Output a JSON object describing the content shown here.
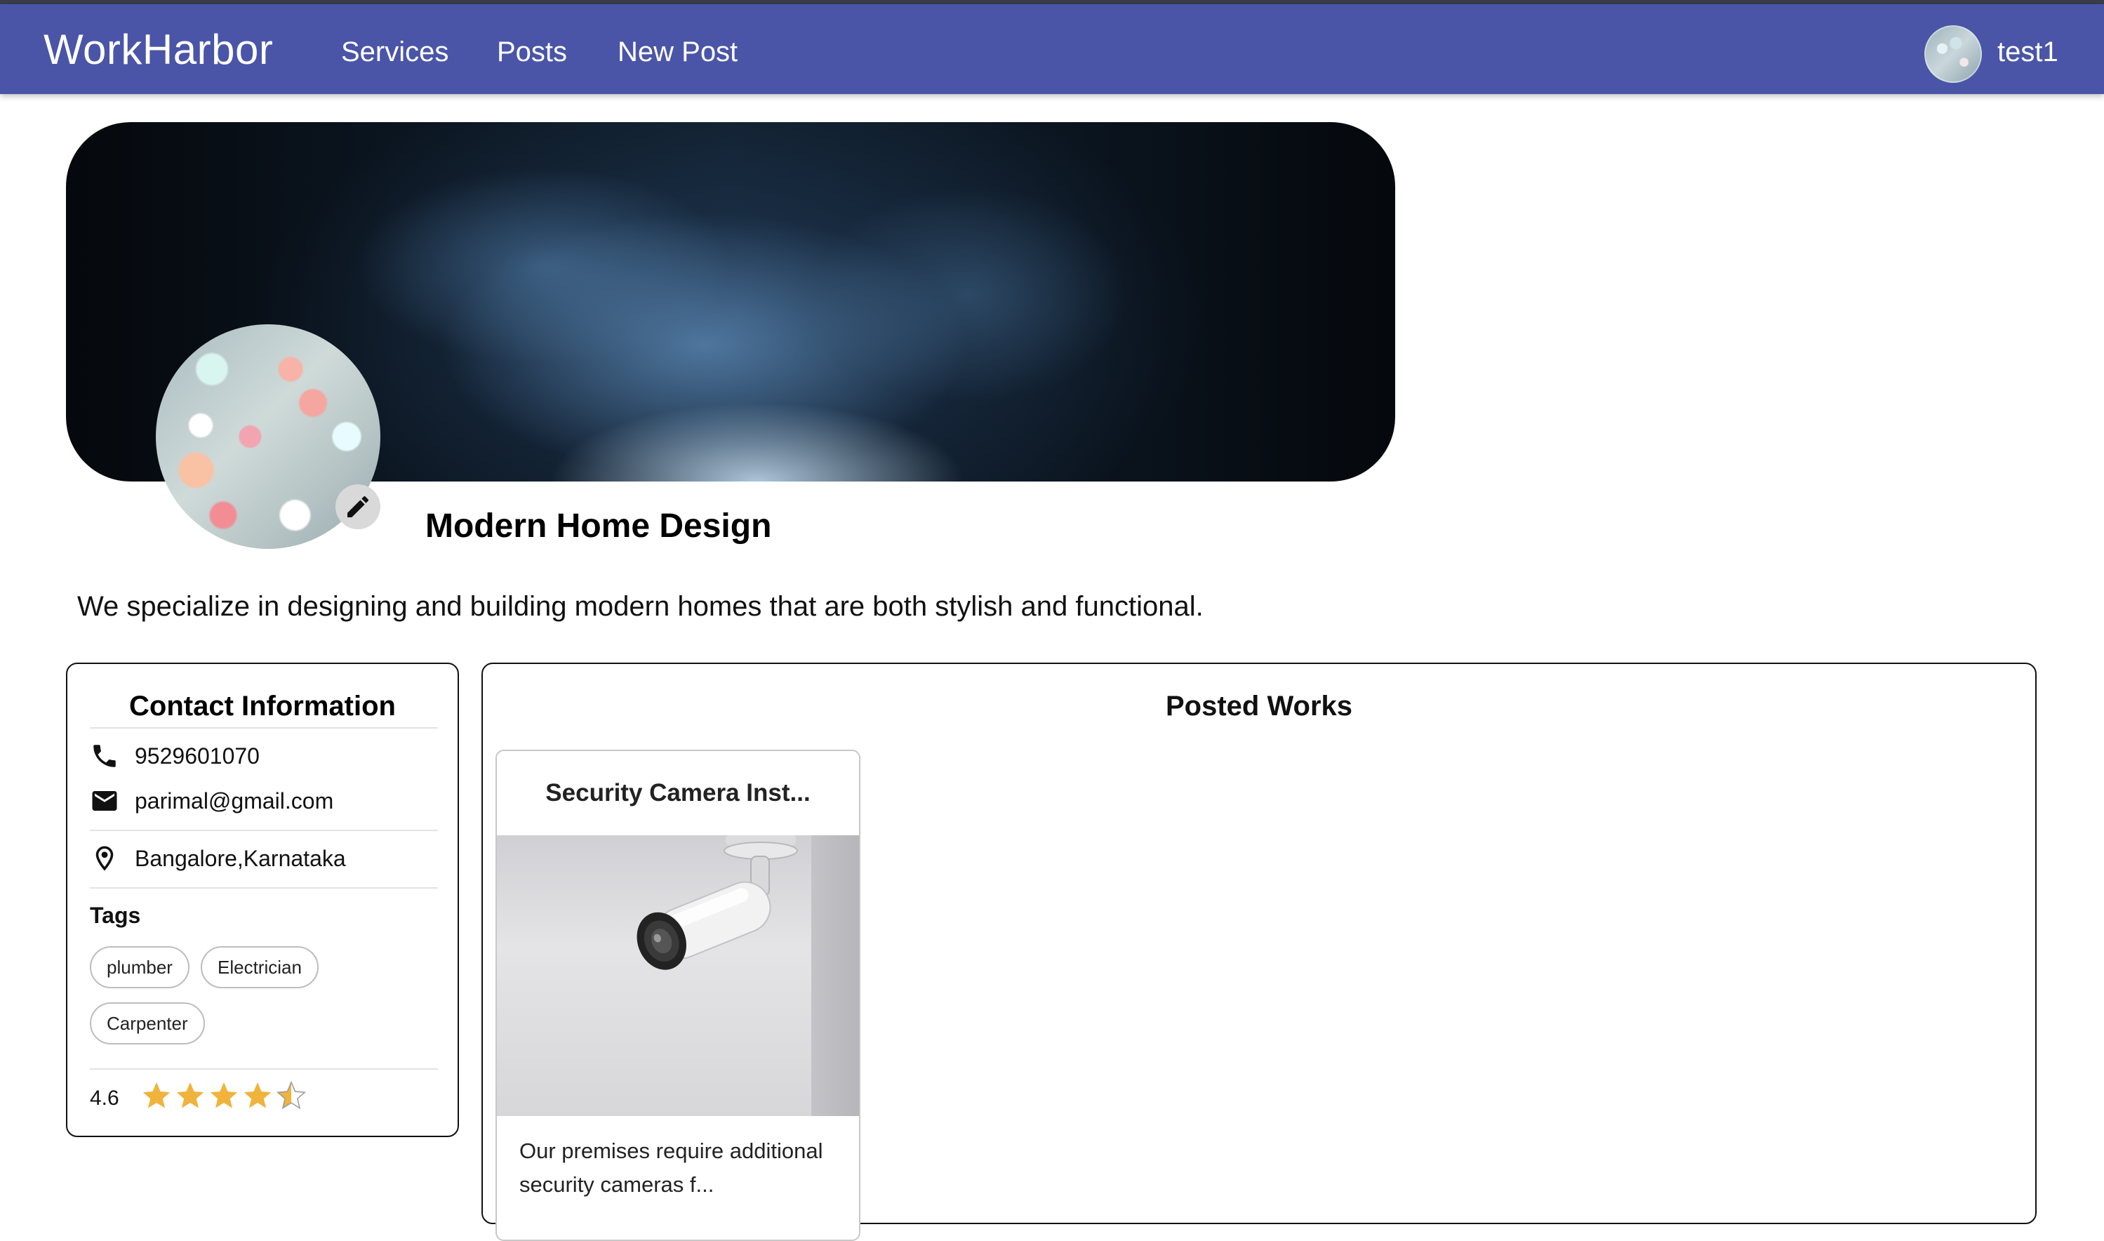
{
  "appbar": {
    "brand": "WorkHarbor",
    "nav": [
      "Services",
      "Posts",
      "New Post"
    ],
    "user": "test1"
  },
  "profile": {
    "title": "Modern Home Design",
    "description": "We specialize in designing and building modern homes that are both stylish and functional."
  },
  "contact": {
    "heading": "Contact Information",
    "phone": "9529601070",
    "email": "parimal@gmail.com",
    "location": "Bangalore,Karnataka",
    "tags_label": "Tags",
    "tags": [
      "plumber",
      "Electrician",
      "Carpenter"
    ],
    "rating": "4.6",
    "stars": 4.6
  },
  "works": {
    "heading": "Posted Works",
    "items": [
      {
        "title": "Security Camera Inst...",
        "text": "Our premises require additional security cameras f..."
      }
    ]
  },
  "icons": [
    "edit-icon",
    "phone-icon",
    "email-icon",
    "location-icon",
    "star-icon",
    "security-camera-image"
  ],
  "colors": {
    "appbar": "#4a55a8",
    "star": "#f0b33c"
  }
}
